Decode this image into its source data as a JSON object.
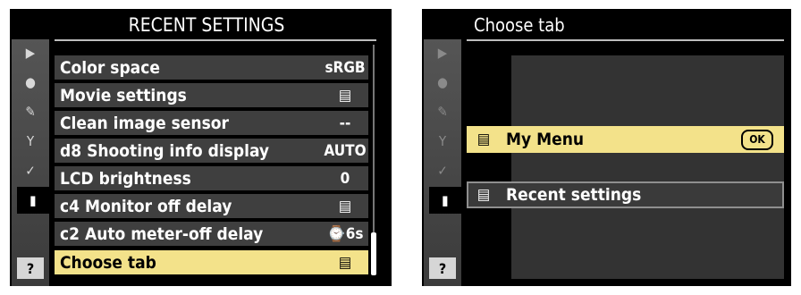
{
  "left_screen": {
    "title": "RECENT SETTINGS",
    "sidebar": {
      "play": "▶",
      "shoot": "●",
      "custom": "✎",
      "setup": "Y",
      "retouch": "✓",
      "recent": "▮",
      "help": "?"
    },
    "items": [
      {
        "label": "Color space",
        "value": "sRGB"
      },
      {
        "label": "Movie settings",
        "value": "▤"
      },
      {
        "label": "Clean image sensor",
        "value": "--"
      },
      {
        "label": "d8 Shooting info display",
        "value": "AUTO"
      },
      {
        "label": "LCD brightness",
        "value": "0"
      },
      {
        "label": "c4 Monitor off delay",
        "value": "▤"
      },
      {
        "label": "c2 Auto meter-off delay",
        "value": "⌚6s"
      },
      {
        "label": "Choose tab",
        "value": "▤"
      }
    ],
    "selected_index": 7,
    "highlight_color": "#f3e28a"
  },
  "right_screen": {
    "title": "Choose tab",
    "sidebar": {
      "play": "▶",
      "shoot": "●",
      "custom": "✎",
      "setup": "Y",
      "retouch": "✓",
      "recent": "▮",
      "help": "?"
    },
    "options": [
      {
        "icon": "▤",
        "label": "My Menu",
        "ok": "OK"
      },
      {
        "icon": "▤",
        "label": "Recent settings"
      }
    ]
  }
}
